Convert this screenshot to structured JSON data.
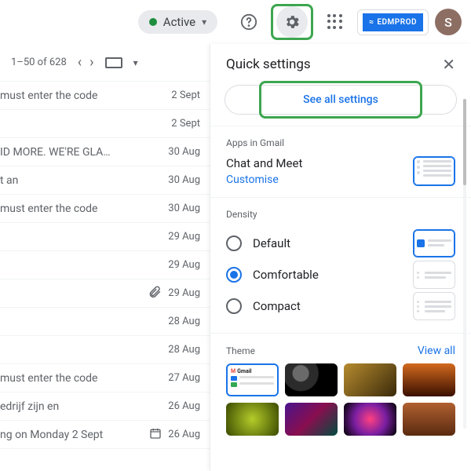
{
  "topbar": {
    "status_label": "Active",
    "brand_label": "EDMPROD",
    "avatar_initial": "S"
  },
  "list": {
    "pager": "1–50 of 628",
    "rows": [
      {
        "subject": "must enter the code",
        "date": "2 Sept"
      },
      {
        "subject": "",
        "date": "2 Sept"
      },
      {
        "subject": "ID MORE. WE'RE GLA…",
        "date": "30 Aug"
      },
      {
        "subject": "t an",
        "date": "30 Aug"
      },
      {
        "subject": "must enter the code",
        "date": "30 Aug"
      },
      {
        "subject": "",
        "date": "29 Aug"
      },
      {
        "subject": "",
        "date": "29 Aug"
      },
      {
        "subject": "",
        "date": "29 Aug",
        "attachment": true
      },
      {
        "subject": "",
        "date": "28 Aug"
      },
      {
        "subject": "",
        "date": "28 Aug"
      },
      {
        "subject": "must enter the code",
        "date": "27 Aug"
      },
      {
        "subject": "edrijf zijn en",
        "date": "26 Aug"
      },
      {
        "subject": "ng on Monday 2 Sept",
        "date": "26 Aug",
        "calendar": true
      }
    ]
  },
  "panel": {
    "title": "Quick settings",
    "see_all": "See all settings",
    "sections": {
      "apps": {
        "label": "Apps in Gmail",
        "item": "Chat and Meet",
        "action": "Customise"
      },
      "density": {
        "label": "Density",
        "options": [
          "Default",
          "Comfortable",
          "Compact"
        ],
        "selected": "Comfortable",
        "preview_selected": "Default"
      },
      "theme": {
        "label": "Theme",
        "view_all": "View all",
        "default_tile_label": "Gmail"
      }
    }
  }
}
